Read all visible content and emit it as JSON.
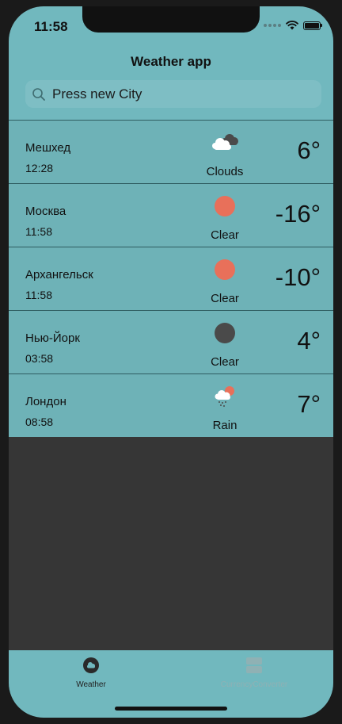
{
  "status": {
    "time": "11:58"
  },
  "header": {
    "title": "Weather app"
  },
  "search": {
    "placeholder": "Press new City"
  },
  "cities": [
    {
      "name": "Мешхед",
      "time": "12:28",
      "condition": "Clouds",
      "temp": "6°",
      "icon": "clouds-icon"
    },
    {
      "name": "Москва",
      "time": "11:58",
      "condition": "Clear",
      "temp": "-16°",
      "icon": "sun-icon"
    },
    {
      "name": "Архангельск",
      "time": "11:58",
      "condition": "Clear",
      "temp": "-10°",
      "icon": "sun-icon"
    },
    {
      "name": "Нью-Йорк",
      "time": "03:58",
      "condition": "Clear",
      "temp": "4°",
      "icon": "moon-icon"
    },
    {
      "name": "Лондон",
      "time": "08:58",
      "condition": "Rain",
      "temp": "7°",
      "icon": "rain-icon"
    }
  ],
  "tabs": {
    "weather": {
      "label": "Weather",
      "icon": "cloud-tab-icon"
    },
    "currency": {
      "label": "CurrencyConverter",
      "icon": "database-tab-icon"
    }
  },
  "colors": {
    "accent": "#71b8be",
    "sun": "#e8705a",
    "moon": "#4a4a4a",
    "background": "#363636"
  }
}
